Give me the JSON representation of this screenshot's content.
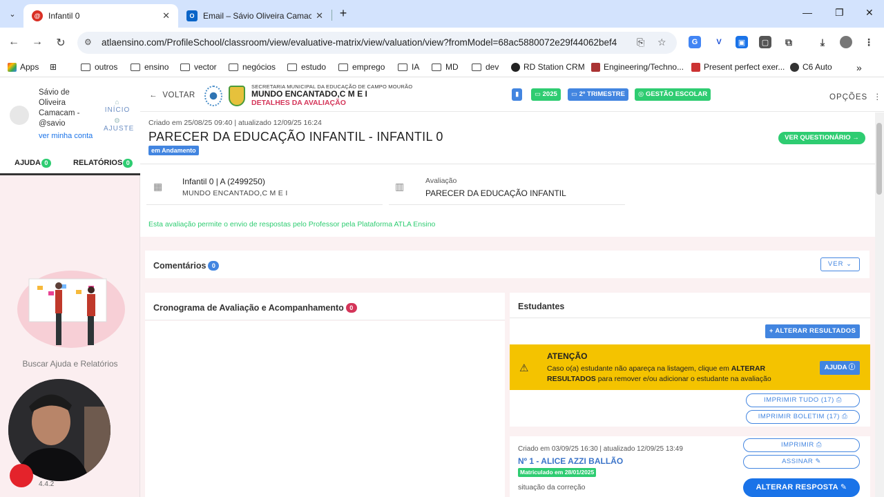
{
  "browser": {
    "tabs": [
      {
        "title": "Infantil 0",
        "icon": "atla-icon"
      },
      {
        "title": "Email – Sávio Oliveira Camacam",
        "icon": "outlook-icon"
      }
    ],
    "new_tab": "+",
    "url": "atlaensino.com/ProfileSchool/classroom/view/evaluative-matrix/view/valuation/view?fromModel=68ac5880072e29f44062bef4",
    "bookmarks": [
      "Apps",
      "outros",
      "ensino",
      "vector",
      "negócios",
      "estudo",
      "emprego",
      "IA",
      "MD",
      "dev",
      "RD Station CRM",
      "Engineering/Techno...",
      "Present perfect exer...",
      "C6 Auto"
    ]
  },
  "sidebar": {
    "user_name": "Sávio de Oliveira Camacam - @savio",
    "user_link": "ver minha conta",
    "inicio": "INÍCIO",
    "ajuste": "AJUSTE",
    "tab_ajuda": "AJUDA",
    "tab_ajuda_count": "0",
    "tab_relatorios": "RELATÓRIOS",
    "tab_relatorios_count": "0",
    "help_text": "Buscar Ajuda e Relatórios",
    "version": "4.4.2"
  },
  "header": {
    "back": "VOLTAR",
    "secretaria": "SECRETARIA MUNICIPAL DA EDUCAÇÃO DE CAMPO MOURÃO",
    "school_name": "MUNDO ENCANTADO,C M E I",
    "subtitle": "DETALHES DA AVALIAÇÃO",
    "pill_year": "2025",
    "pill_trimestre": "2º TRIMESTRE",
    "pill_gestao": "GESTÃO ESCOLAR",
    "options": "OPÇÕES",
    "colors": {
      "green": "#2ecc71",
      "blue": "#4285e0",
      "pink": "#d43559"
    }
  },
  "evaluation": {
    "created": "Criado em 25/08/25 09:40 | atualizado 12/09/25 16:24",
    "title": "PARECER DA EDUCAÇÃO INFANTIL - INFANTIL 0",
    "status": "em Andamento",
    "ver_questionario": "VER QUESTIONÁRIO →",
    "class_main": "Infantil 0 | A (2499250)",
    "class_sub": "MUNDO ENCANTADO,C M E I",
    "avaliacao_label": "Avaliação",
    "avaliacao_value": "PARECER DA EDUCAÇÃO INFANTIL",
    "notice": "Esta avaliação permite o envio de respostas pelo Professor pela Plataforma ATLA Ensino"
  },
  "comentarios": {
    "title": "Comentários",
    "count": "0",
    "ver": "VER ⌄"
  },
  "cronograma": {
    "title": "Cronograma de Avaliação e Acompanhamento",
    "count": "0"
  },
  "estudantes": {
    "title": "Estudantes",
    "alterar_resultados": "+ ALTERAR RESULTADOS",
    "alert_title": "ATENÇÃO",
    "alert_text_1": "Caso o(a) estudante não apareça na listagem, clique em ",
    "alert_bold_1": "ALTERAR RESULTADOS",
    "alert_text_2": " para remover e/ou adicionar o estudante na avaliação",
    "ajuda": "AJUDA ⓘ",
    "imprimir_tudo": "IMPRIMIR TUDO (17)",
    "imprimir_boletim": "IMPRIMIR BOLETIM (17)",
    "student": {
      "created": "Criado em 03/09/25 16:30 | atualizado 12/09/25 13:49",
      "name": "Nº 1 - ALICE AZZI BALLÃO",
      "badge": "Matriculado em 28/01/2025",
      "situacao": "situação da correção",
      "imprimir": "IMPRIMIR",
      "assinar": "ASSINAR",
      "alterar_resposta": "ALTERAR RESPOSTA"
    }
  }
}
